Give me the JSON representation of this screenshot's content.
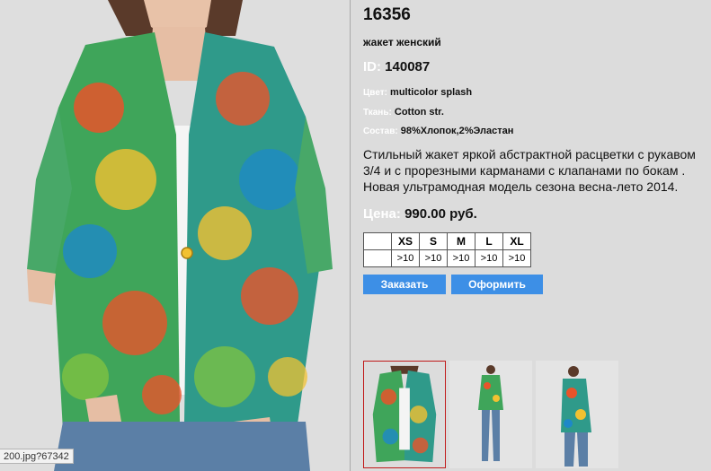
{
  "product": {
    "article": "16356",
    "subtitle": "жакет женский",
    "id_label": "ID:",
    "id_value": "140087",
    "color_label": "Цвет:",
    "color_value": "multicolor splash",
    "fabric_label": "Ткань:",
    "fabric_value": "Cotton str.",
    "composition_label": "Состав:",
    "composition_value": "98%Хлопок,2%Эластан",
    "description": "Стильный жакет яркой абстрактной расцветки с рукавом 3/4 и с прорезными карманами с клапанами по бокам . Новая ультрамодная модель сезона весна-лето 2014.",
    "price_label": "Цена:",
    "price_value": "990.00 руб."
  },
  "sizes": {
    "headers": [
      "XS",
      "S",
      "M",
      "L",
      "XL"
    ],
    "stock": [
      ">10",
      ">10",
      ">10",
      ">10",
      ">10"
    ]
  },
  "buttons": {
    "order": "Заказать",
    "checkout": "Оформить"
  },
  "status_url": "200.jpg?67342",
  "colors": {
    "label": "#ffffff",
    "button": "#3d8fe6",
    "active_thumb_border": "#c01a1a"
  }
}
